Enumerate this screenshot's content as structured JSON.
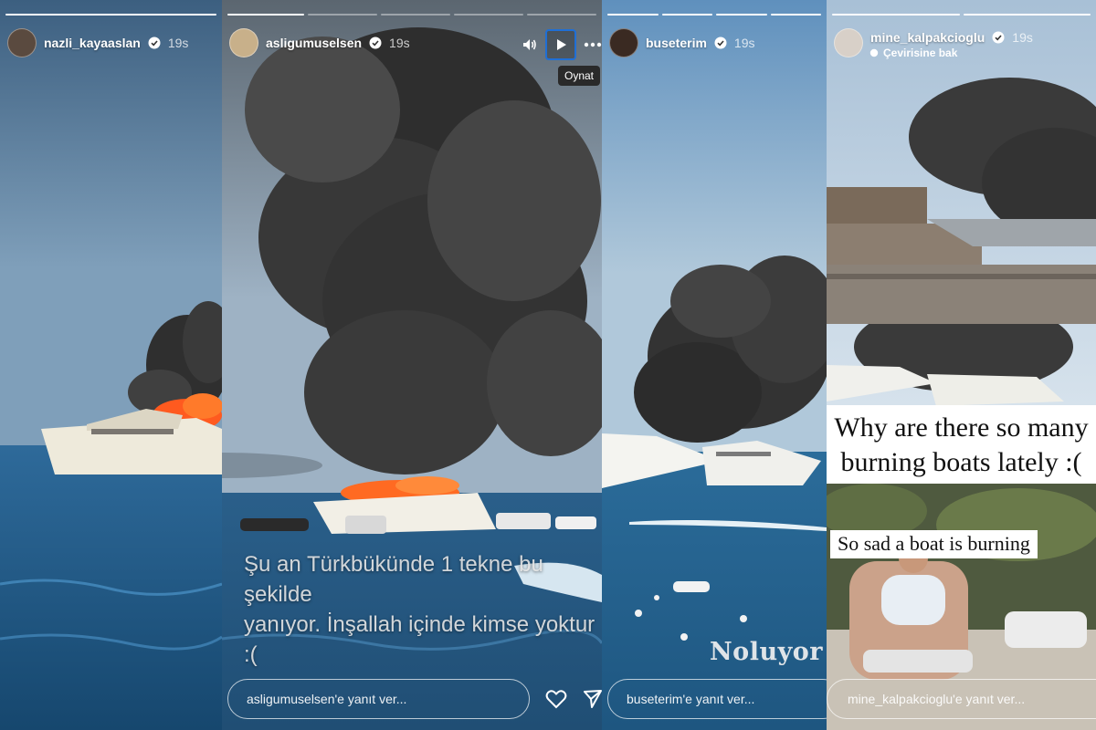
{
  "stories": [
    {
      "username": "nazli_kayaaslan",
      "age": "19s"
    },
    {
      "username": "asligumuselsen",
      "age": "19s",
      "tooltip": "Oynat",
      "caption_line1": "Şu an Türkbükünde 1 tekne bu şekilde",
      "caption_line2": "yanıyor. İnşallah içinde kimse yoktur :(",
      "reply_placeholder": "asligumuselsen'e yanıt ver..."
    },
    {
      "username": "buseterim",
      "age": "19s",
      "overlay_text": "Noluyor",
      "reply_placeholder": "buseterim'e yanıt ver..."
    },
    {
      "username": "mine_kalpakcioglu",
      "age": "19s",
      "translate_label": "Çevirisine bak",
      "meme_line1": "Why are there so many",
      "meme_line2": "burning boats lately :(",
      "meme_tag": "So sad a boat is burning",
      "reply_placeholder": "mine_kalpakcioglu'e yanıt ver..."
    }
  ],
  "colors": {
    "verified_badge": "#ffffff",
    "play_focus_outline": "#1f6fd6",
    "fire": "#ff5a1f",
    "smoke": "#3a3a3a",
    "sea": "#1f5f8f"
  },
  "icons": [
    "verified-icon",
    "volume-icon",
    "play-icon",
    "more-icon",
    "heart-icon",
    "send-icon",
    "translate-icon"
  ]
}
